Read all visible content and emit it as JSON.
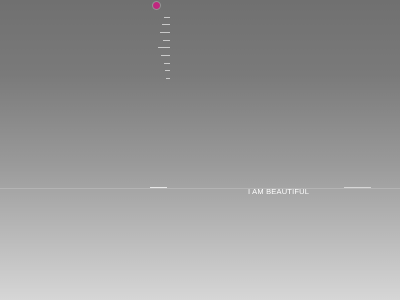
{
  "header": {
    "logo_icon": "circle-logo-icon",
    "logo_color": "#c0287f"
  },
  "nav": {
    "item_count": 9
  },
  "hero": {
    "title": "I AM BEAUTIFUL"
  },
  "colors": {
    "background_top": "#707070",
    "background_bottom": "#d6d6d6",
    "title_text": "#ffffff"
  }
}
